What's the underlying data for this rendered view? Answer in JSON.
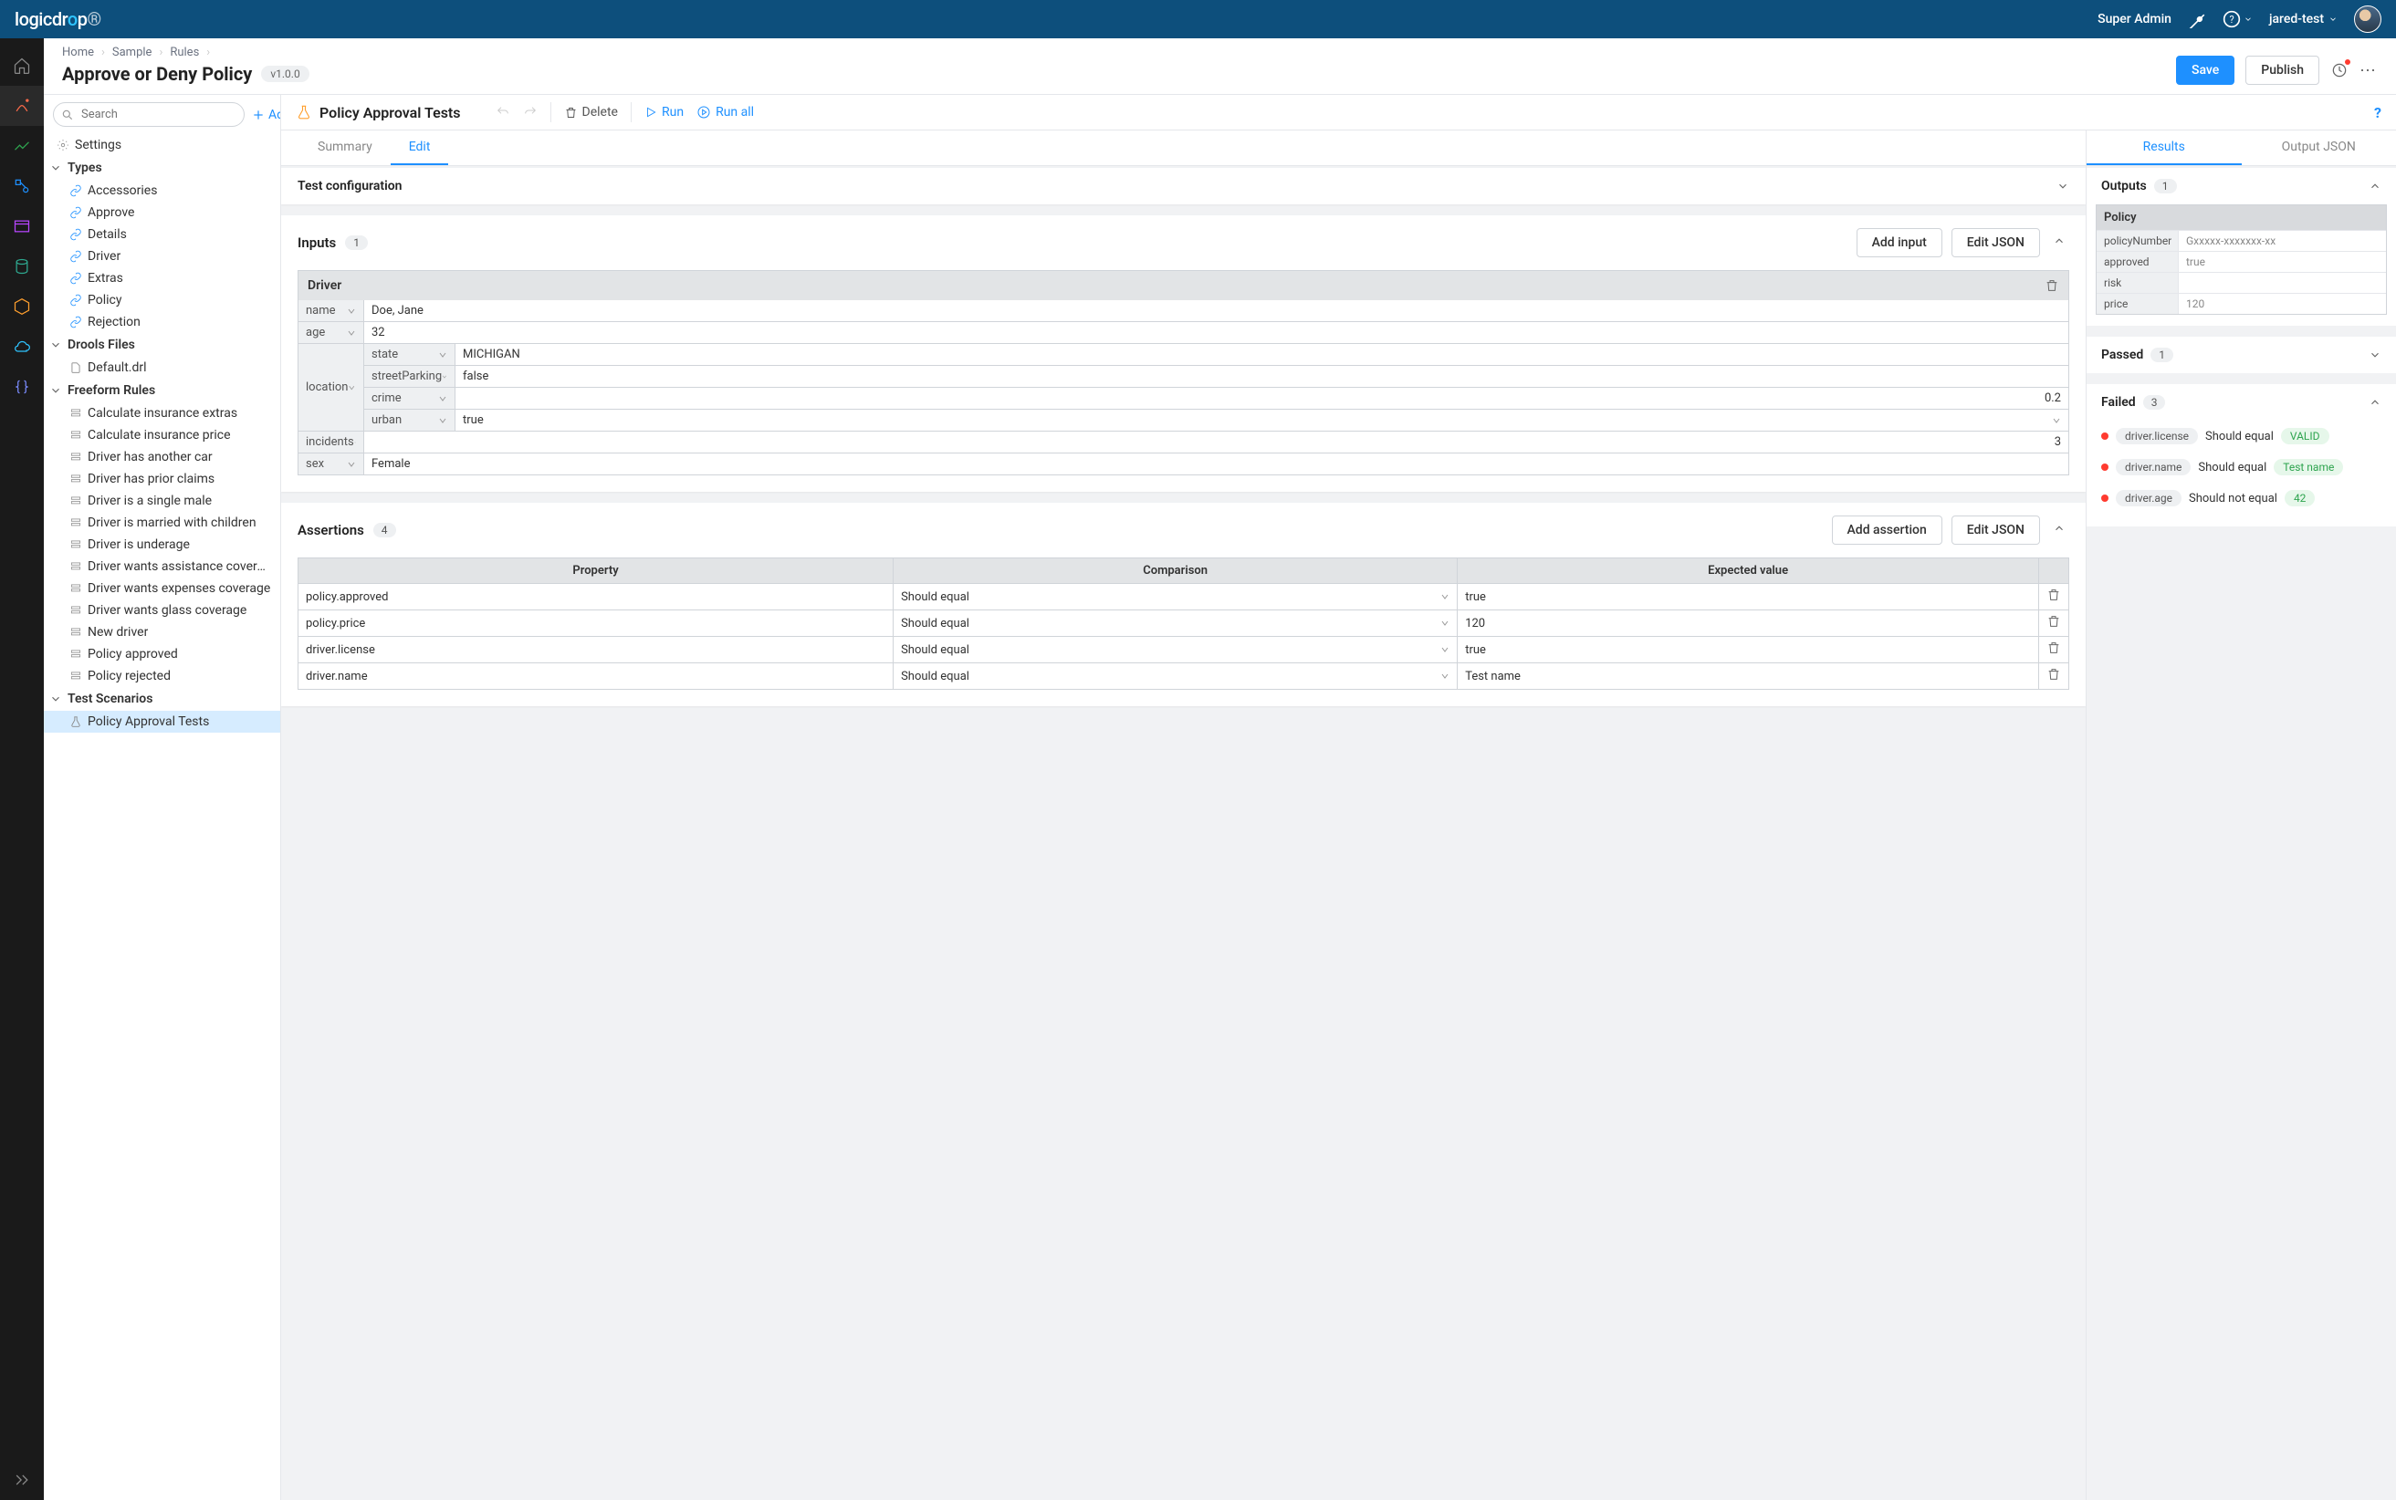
{
  "topbar": {
    "role": "Super Admin",
    "project": "jared-test"
  },
  "breadcrumb": [
    "Home",
    "Sample",
    "Rules"
  ],
  "page": {
    "title": "Approve or Deny Policy",
    "version": "v1.0.0",
    "save": "Save",
    "publish": "Publish"
  },
  "sidebar": {
    "searchPlaceholder": "Search",
    "add": "Add",
    "settings": "Settings",
    "sections": {
      "types": {
        "label": "Types",
        "items": [
          "Accessories",
          "Approve",
          "Details",
          "Driver",
          "Extras",
          "Policy",
          "Rejection"
        ]
      },
      "drools": {
        "label": "Drools Files",
        "items": [
          "Default.drl"
        ]
      },
      "freeform": {
        "label": "Freeform Rules",
        "items": [
          "Calculate insurance extras",
          "Calculate insurance price",
          "Driver has another car",
          "Driver has prior claims",
          "Driver is a single male",
          "Driver is married with children",
          "Driver is underage",
          "Driver wants assistance coverage",
          "Driver wants expenses coverage",
          "Driver wants glass coverage",
          "New driver",
          "Policy approved",
          "Policy rejected"
        ]
      },
      "scenarios": {
        "label": "Test Scenarios",
        "items": [
          "Policy Approval Tests"
        ]
      }
    }
  },
  "toolbar": {
    "title": "Policy Approval Tests",
    "delete": "Delete",
    "run": "Run",
    "runall": "Run all"
  },
  "tabs": {
    "summary": "Summary",
    "edit": "Edit"
  },
  "testconfig": {
    "title": "Test configuration"
  },
  "inputs": {
    "title": "Inputs",
    "count": "1",
    "addInput": "Add input",
    "editJson": "Edit JSON",
    "driver": {
      "title": "Driver",
      "name": {
        "k": "name",
        "v": "Doe, Jane"
      },
      "age": {
        "k": "age",
        "v": "32"
      },
      "location": {
        "k": "location",
        "state": {
          "k": "state",
          "v": "MICHIGAN"
        },
        "streetParking": {
          "k": "streetParking",
          "v": "false"
        },
        "crime": {
          "k": "crime",
          "v": "0.2"
        },
        "urban": {
          "k": "urban",
          "v": "true"
        }
      },
      "incidents": {
        "k": "incidents",
        "v": "3"
      },
      "sex": {
        "k": "sex",
        "v": "Female"
      }
    }
  },
  "assertions": {
    "title": "Assertions",
    "count": "4",
    "addAssertion": "Add assertion",
    "editJson": "Edit JSON",
    "headers": {
      "property": "Property",
      "comparison": "Comparison",
      "expected": "Expected value"
    },
    "rows": [
      {
        "property": "policy.approved",
        "comparison": "Should equal",
        "expected": "true"
      },
      {
        "property": "policy.price",
        "comparison": "Should equal",
        "expected": "120"
      },
      {
        "property": "driver.license",
        "comparison": "Should equal",
        "expected": "true"
      },
      {
        "property": "driver.name",
        "comparison": "Should equal",
        "expected": "Test name"
      }
    ]
  },
  "rtabs": {
    "results": "Results",
    "output": "Output JSON"
  },
  "outputs": {
    "title": "Outputs",
    "count": "1",
    "policyHead": "Policy",
    "rows": [
      {
        "k": "policyNumber",
        "v": "Gxxxxx-xxxxxxx-xx"
      },
      {
        "k": "approved",
        "v": "true"
      },
      {
        "k": "risk",
        "v": ""
      },
      {
        "k": "price",
        "v": "120"
      }
    ]
  },
  "passed": {
    "title": "Passed",
    "count": "1"
  },
  "failed": {
    "title": "Failed",
    "count": "3",
    "rows": [
      {
        "prop": "driver.license",
        "txt": "Should equal",
        "val": "VALID"
      },
      {
        "prop": "driver.name",
        "txt": "Should equal",
        "val": "Test name"
      },
      {
        "prop": "driver.age",
        "txt": "Should not equal",
        "val": "42"
      }
    ]
  }
}
